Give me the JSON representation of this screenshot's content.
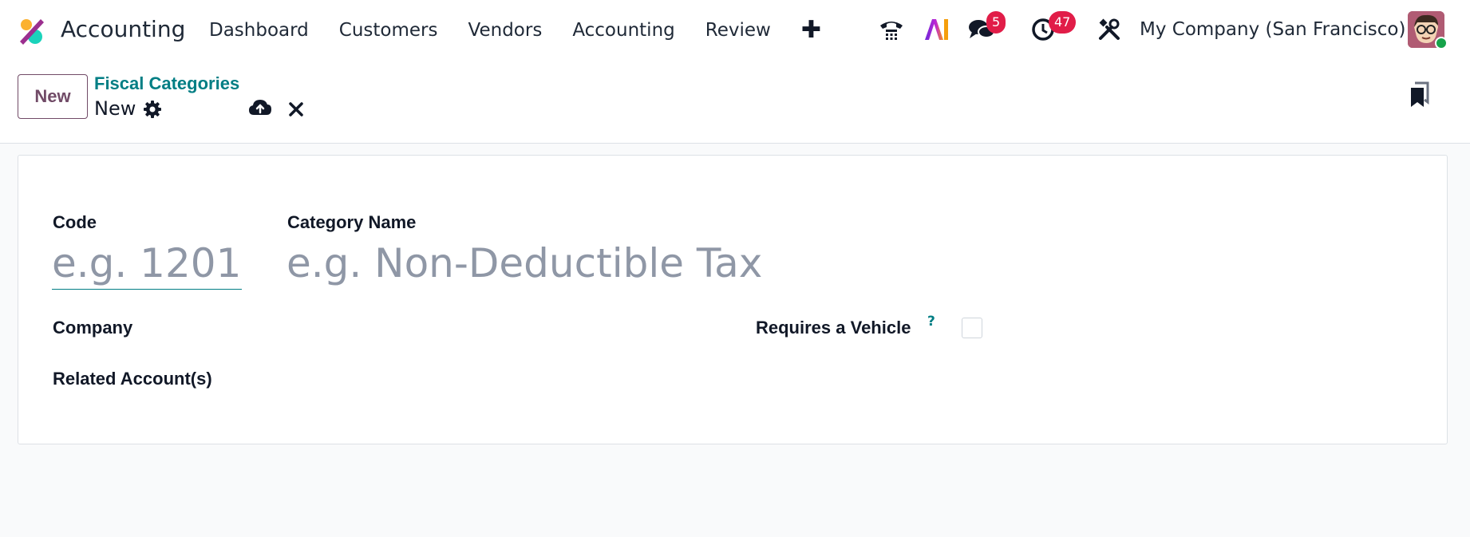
{
  "navbar": {
    "app_name": "Accounting",
    "menu": [
      "Dashboard",
      "Customers",
      "Vendors",
      "Accounting",
      "Review"
    ],
    "plus_icon": "plus-icon",
    "icons": [
      "phone-icon",
      "ai-icon",
      "chat-icon",
      "activity-clock-icon",
      "tools-icon"
    ],
    "messages_count": "5",
    "activities_count": "47",
    "company": "My Company (San Francisco)",
    "badge_color": "#e11d48",
    "status_color": "#16a34a"
  },
  "control_panel": {
    "new_label": "New",
    "breadcrumb": "Fiscal Categories",
    "record_title": "New",
    "icons": [
      "gear-icon",
      "cloud-upload-icon",
      "close-icon",
      "bookmark-icon"
    ],
    "accent_color": "#714b67",
    "link_color": "#017e84"
  },
  "form": {
    "code_label": "Code",
    "code_value": "",
    "code_placeholder": "e.g. 1201",
    "name_label": "Category Name",
    "name_value": "",
    "name_placeholder": "e.g. Non-Deductible Tax",
    "company_label": "Company",
    "company_value": "",
    "related_accounts_label": "Related Account(s)",
    "related_accounts_value": "",
    "vehicle_label": "Requires a Vehicle",
    "vehicle_help": "?",
    "vehicle_checked": false
  }
}
